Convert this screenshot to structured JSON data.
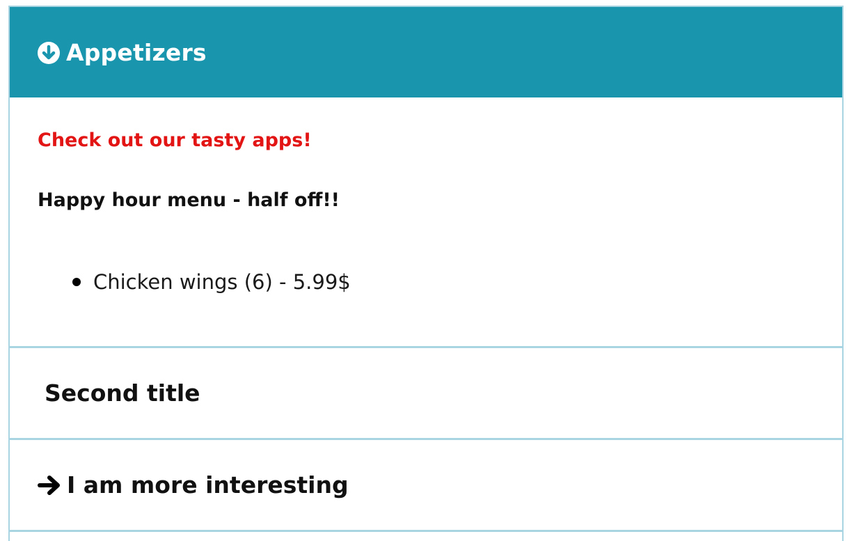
{
  "accordion": {
    "panels": [
      {
        "title": "Appetizers",
        "icon": "circle-arrow-down-icon",
        "expanded": true,
        "header_color": "#1a95ae",
        "content": {
          "tagline": "Check out our tasty apps!",
          "tagline_color": "#e21414",
          "subheading": "Happy hour menu - half off!!",
          "items": [
            "Chicken wings (6) - 5.99$"
          ]
        }
      },
      {
        "title": "Second title",
        "expanded": false
      },
      {
        "title": "I am more interesting",
        "icon": "arrow-right-icon",
        "expanded": false
      }
    ],
    "border_color": "#a9d5e2"
  }
}
